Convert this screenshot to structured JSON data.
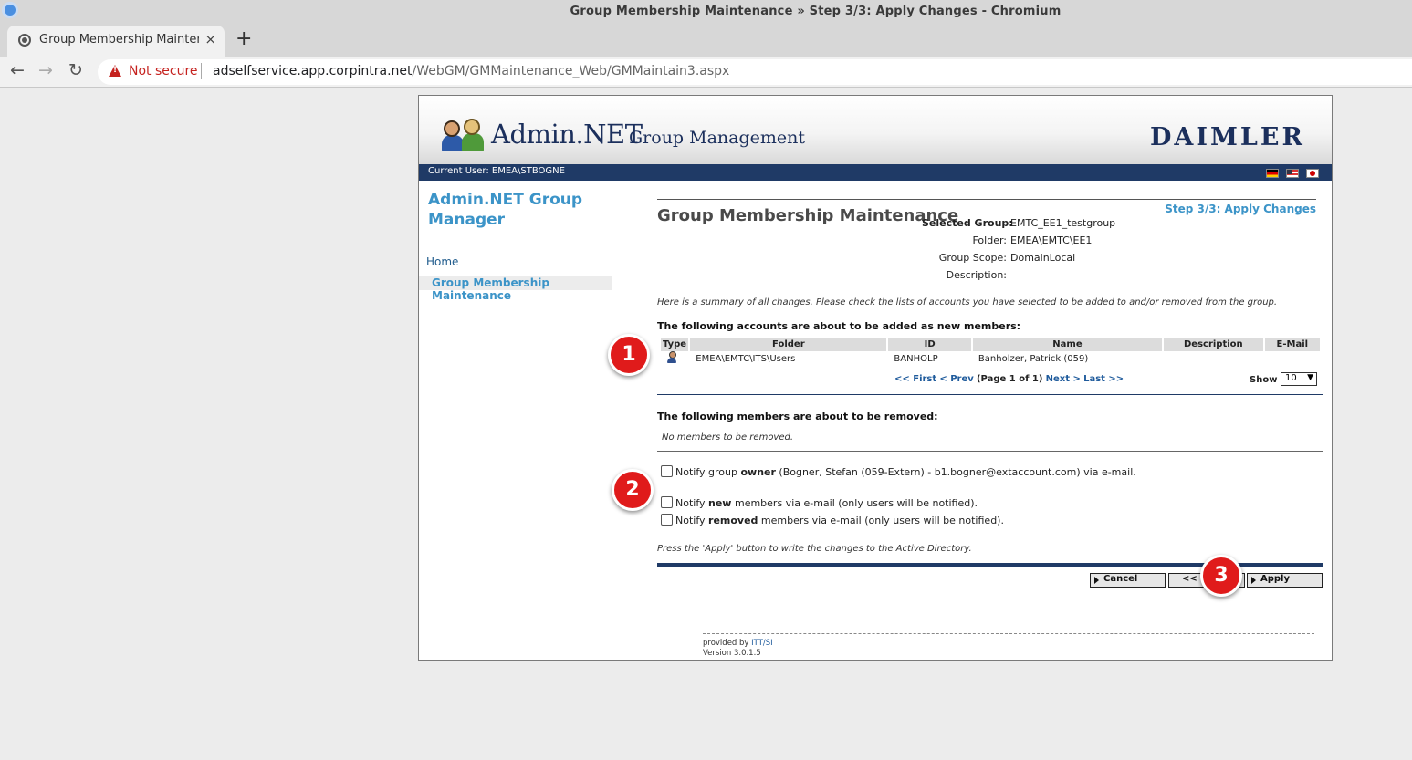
{
  "browser": {
    "window_title": "Group Membership Maintenance » Step 3/3: Apply Changes - Chromium",
    "tab_title": "Group Membership Maintenance » Step 3/3: Apply Changes",
    "tab_close": "×",
    "new_tab": "+",
    "not_secure": "Not secure",
    "url_host": "adselfservice.app.corpintra.net",
    "url_path": "/WebGM/GMMaintenance_Web/GMMaintain3.aspx"
  },
  "header": {
    "brand_main": "Admin.NET",
    "brand_sub": "Group Management",
    "company": "DAIMLER",
    "current_user": "Current User: EMEA\\STBOGNE"
  },
  "sidebar": {
    "title": "Admin.NET Group Manager",
    "home": "Home",
    "active_item": "Group Membership Maintenance"
  },
  "main": {
    "title": "Group Membership Maintenance",
    "step": "Step 3/3: Apply Changes",
    "group_info": [
      {
        "label": "Selected Group:",
        "value": "EMTC_EE1_testgroup"
      },
      {
        "label": "Folder:",
        "value": "EMEA\\EMTC\\EE1"
      },
      {
        "label": "Group Scope:",
        "value": "DomainLocal"
      },
      {
        "label": "Description:",
        "value": ""
      }
    ],
    "summary": "Here is a summary of all changes. Please check the lists of accounts you have selected to be added to and/or removed from the group.",
    "added_header": "The following accounts are about to be added as new members:",
    "columns": [
      "Type",
      "Folder",
      "ID",
      "Name",
      "Description",
      "E-Mail"
    ],
    "rows": [
      {
        "folder": "EMEA\\EMTC\\ITS\\Users",
        "id": "BANHOLP",
        "name": "Banholzer, Patrick (059)",
        "description": "",
        "email": ""
      }
    ],
    "pager": {
      "first": "<< First",
      "prev": "< Prev",
      "page_info": "(Page 1 of 1)",
      "next": "Next >",
      "last": "Last >>"
    },
    "show_label": "Show",
    "show_value": "10",
    "removed_header": "The following members are about to be removed:",
    "no_members": "No members to be removed.",
    "notify_owner": {
      "pre": "Notify group ",
      "bold": "owner",
      "post": " (Bogner, Stefan (059-Extern) - b1.bogner@extaccount.com) via e-mail."
    },
    "notify_new": {
      "pre": "Notify ",
      "bold": "new",
      "post": " members via e-mail (only users will be notified)."
    },
    "notify_removed": {
      "pre": "Notify ",
      "bold": "removed",
      "post": " members via e-mail (only users will be notified)."
    },
    "press_apply": "Press the 'Apply' button to write the changes to the Active Directory.",
    "buttons": {
      "cancel": "Cancel",
      "back": "<< Back",
      "apply": "Apply"
    },
    "footer_provided": "provided by ",
    "footer_link": "ITT/SI",
    "footer_version": "Version 3.0.1.5"
  },
  "markers": [
    "1",
    "2",
    "3"
  ]
}
